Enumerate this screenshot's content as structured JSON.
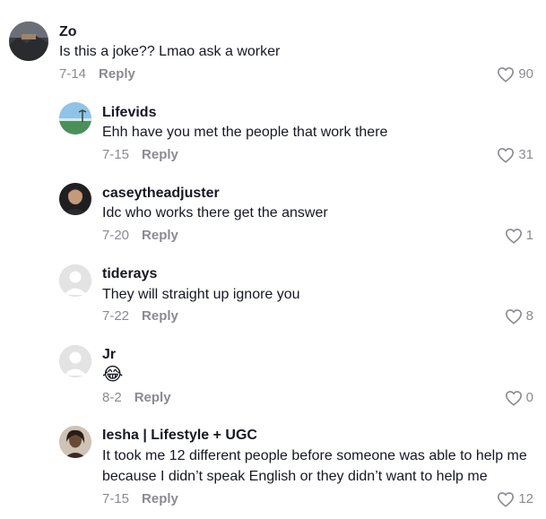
{
  "comments": [
    {
      "username": "Zo",
      "text": "Is this a joke?? Lmao ask a worker",
      "date": "7-14",
      "reply_label": "Reply",
      "likes": "90",
      "avatar": "dark-landscape-avatar"
    },
    {
      "username": "Lifevids",
      "text": "Ehh have you met the people that work there",
      "date": "7-15",
      "reply_label": "Reply",
      "likes": "31",
      "avatar": "beach-landscape-avatar"
    },
    {
      "username": "caseytheadjuster",
      "text": "Idc who works there get the answer",
      "date": "7-20",
      "reply_label": "Reply",
      "likes": "1",
      "avatar": "person-photo-avatar"
    },
    {
      "username": "tiderays",
      "text": "They will straight up ignore you",
      "date": "7-22",
      "reply_label": "Reply",
      "likes": "8",
      "avatar": "default-avatar"
    },
    {
      "username": "Jr",
      "text": "😂",
      "date": "8-2",
      "reply_label": "Reply",
      "likes": "0",
      "avatar": "default-avatar"
    },
    {
      "username": "Iesha | Lifestyle + UGC",
      "text": "It took me 12 different people before someone was able to help me because I didn’t speak English or they didn’t want to help me",
      "date": "7-15",
      "reply_label": "Reply",
      "likes": "12",
      "avatar": "person-photo-avatar"
    }
  ],
  "colors": {
    "text": "#161823",
    "muted": "#8a8b91",
    "background": "#ffffff"
  }
}
